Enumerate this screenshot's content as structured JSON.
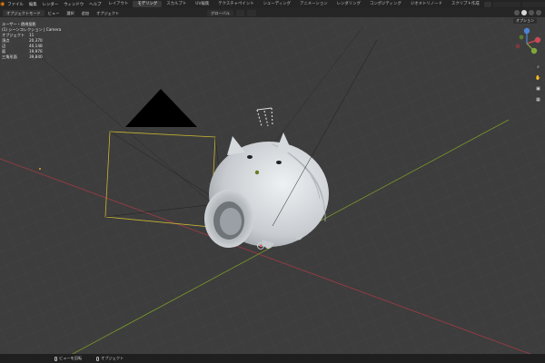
{
  "app_menu": [
    "ファイル",
    "編集",
    "レンダー",
    "ウィンドウ",
    "ヘルプ"
  ],
  "workspaces": [
    "レイアウト",
    "モデリング",
    "スカルプト",
    "UV編集",
    "テクスチャペイント",
    "シェーディング",
    "アニメーション",
    "レンダリング",
    "コンポジティング",
    "ジオメトリノード",
    "スクリプト作成"
  ],
  "active_workspace": "モデリング",
  "viewport_header": {
    "mode": "オブジェクトモード",
    "menus": [
      "ビュー",
      "選択",
      "追加",
      "オブジェクト"
    ],
    "pivot": "グローバル"
  },
  "stats_overlay": {
    "title": "ユーザー・透視投影",
    "collection": "(1) シーンコレクション | Camera",
    "rows": [
      {
        "label": "オブジェクト",
        "value": "11"
      },
      {
        "label": "頂点",
        "value": "20,370"
      },
      {
        "label": "辺",
        "value": "40,148"
      },
      {
        "label": "面",
        "value": "19,976"
      },
      {
        "label": "三角形面",
        "value": "39,840"
      }
    ]
  },
  "options_tab": "オプション",
  "statusbar": [
    "ビューを回転",
    "オブジェクト"
  ],
  "colors": {
    "x_axis": "#a23a45",
    "y_axis": "#7b9a2a",
    "camera_frame": "#c9b531",
    "model": "#d9dde0"
  }
}
